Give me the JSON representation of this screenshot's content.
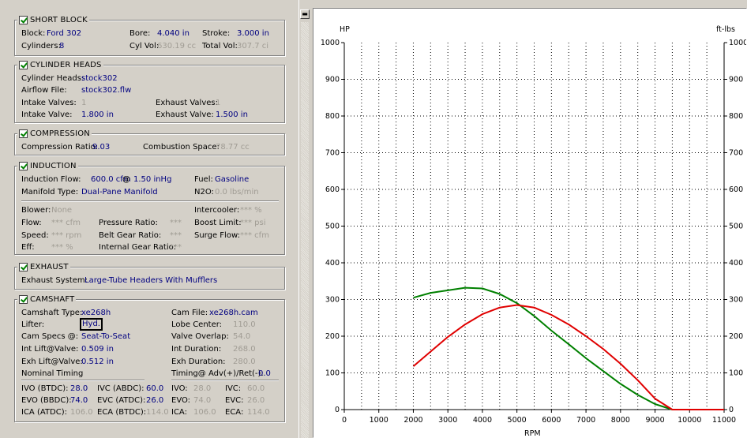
{
  "short_block": {
    "title": "SHORT BLOCK",
    "block_label": "Block:",
    "block": "Ford 302",
    "cyl_label": "Cylinders:",
    "cylinders": "8",
    "bore_label": "Bore:",
    "bore": "4.040 in",
    "cylvol_label": "Cyl Vol:",
    "cylvol": "630.19 cc",
    "stroke_label": "Stroke:",
    "stroke": "3.000 in",
    "totalvol_label": "Total Vol:",
    "totalvol": "307.7 ci"
  },
  "cylinder_heads": {
    "title": "CYLINDER HEADS",
    "heads_label": "Cylinder Heads:",
    "heads": "stock302",
    "airflow_label": "Airflow File:",
    "airflow": "stock302.flw",
    "intake_valves_label": "Intake Valves:",
    "intake_valves": "1",
    "exhaust_valves_label": "Exhaust Valves:",
    "exhaust_valves": "1",
    "intake_valve_label": "Intake Valve:",
    "intake_valve": "1.800 in",
    "exhaust_valve_label": "Exhaust Valve:",
    "exhaust_valve": "1.500 in"
  },
  "compression": {
    "title": "COMPRESSION",
    "ratio_label": "Compression Ratio:",
    "ratio": "9.03",
    "space_label": "Combustion Space:",
    "space": "78.77 cc"
  },
  "induction": {
    "title": "INDUCTION",
    "flow_label": "Induction Flow:",
    "flow": "600.0 cfm",
    "at": "@",
    "flow_pressure": "1.50 inHg",
    "fuel_label": "Fuel:",
    "fuel": "Gasoline",
    "manifold_label": "Manifold Type:",
    "manifold": "Dual-Pane Manifold",
    "n2o_label": "N2O:",
    "n2o": "0.0 lbs/min",
    "blower_label": "Blower:",
    "blower": "None",
    "intercooler_label": "Intercooler:",
    "intercooler": "*** %",
    "flow2_label": "Flow:",
    "flow2": "*** cfm",
    "pressure_label": "Pressure Ratio:",
    "pressure": "***",
    "boost_label": "Boost Limit:",
    "boost": "*** psi",
    "speed_label": "Speed:",
    "speed": "*** rpm",
    "belt_label": "Belt Gear Ratio:",
    "belt": "***",
    "surge_label": "Surge Flow:",
    "surge": "*** cfm",
    "eff_label": "Eff:",
    "eff": "*** %",
    "internal_label": "Internal Gear Ratio:",
    "internal": "***"
  },
  "exhaust": {
    "title": "EXHAUST",
    "system_label": "Exhaust System:",
    "system": "Large-Tube Headers With Mufflers"
  },
  "camshaft": {
    "title": "CAMSHAFT",
    "type_label": "Camshaft Type:",
    "type": "xe268h",
    "file_label": "Cam File:",
    "file": "xe268h.cam",
    "lifter_label": "Lifter:",
    "lifter": "Hyd.",
    "lobe_label": "Lobe Center:",
    "lobe": "110.0",
    "specs_label": "Cam Specs @:",
    "specs": "Seat-To-Seat",
    "overlap_label": "Valve Overlap:",
    "overlap": "54.0",
    "intlift_label": "Int Lift@Valve:",
    "intlift": "0.509 in",
    "intdur_label": "Int Duration:",
    "intdur": "268.0",
    "exhlift_label": "Exh Lift@Valve:",
    "exhlift": "0.512 in",
    "exhdur_label": "Exh Duration:",
    "exhdur": "280.0",
    "timing_label": "Nominal Timing",
    "timingadv_label": "Timing@ Adv(+)/Ret(-):",
    "timingadv": "0.0",
    "ivo_label": "IVO  (BTDC):",
    "ivo": "28.0",
    "ivc_label": "IVC  (ABDC):",
    "ivc": "60.0",
    "evo_label": "EVO (BBDC):",
    "evo": "74.0",
    "evc_label": "EVC (ATDC):",
    "evc": "26.0",
    "ica_label": "ICA  (ATDC):",
    "ica": "106.0",
    "eca_label": "ECA (BTDC):",
    "eca": "114.0",
    "ivo2_label": "IVO:",
    "ivo2": "28.0",
    "ivc2_label": "IVC:",
    "ivc2": "60.0",
    "evo2_label": "EVO:",
    "evo2": "74.0",
    "evc2_label": "EVC:",
    "evc2": "26.0",
    "ica2_label": "ICA:",
    "ica2": "106.0",
    "eca2_label": "ECA:",
    "eca2": "114.0"
  },
  "scrollbar": {
    "up_arrow": "▬"
  },
  "chart_data": {
    "type": "line",
    "xlabel": "RPM",
    "ylabel_left": "HP",
    "ylabel_right": "ft-lbs",
    "xlim": [
      0,
      11000
    ],
    "ylim": [
      0,
      1000
    ],
    "x_ticks": [
      0,
      1000,
      2000,
      3000,
      4000,
      5000,
      6000,
      7000,
      8000,
      9000,
      10000,
      11000
    ],
    "y_ticks": [
      0,
      100,
      200,
      300,
      400,
      500,
      600,
      700,
      800,
      900,
      1000
    ],
    "grid": true,
    "series": [
      {
        "color": "#008000",
        "x": [
          2000,
          2500,
          3000,
          3500,
          4000,
          4500,
          5000,
          5500,
          6000,
          6500,
          7000,
          7500,
          8000,
          8500,
          9000,
          9500,
          10000,
          11000
        ],
        "values": [
          305,
          318,
          325,
          332,
          330,
          315,
          290,
          255,
          215,
          178,
          140,
          105,
          70,
          40,
          15,
          0,
          0,
          0
        ]
      },
      {
        "color": "#e00000",
        "x": [
          2000,
          2500,
          3000,
          3500,
          4000,
          4500,
          5000,
          5500,
          6000,
          6500,
          7000,
          7500,
          8000,
          8500,
          9000,
          9500,
          10000,
          11000
        ],
        "values": [
          118,
          158,
          198,
          232,
          260,
          278,
          285,
          278,
          258,
          232,
          200,
          165,
          125,
          80,
          30,
          0,
          0,
          0
        ]
      }
    ]
  }
}
